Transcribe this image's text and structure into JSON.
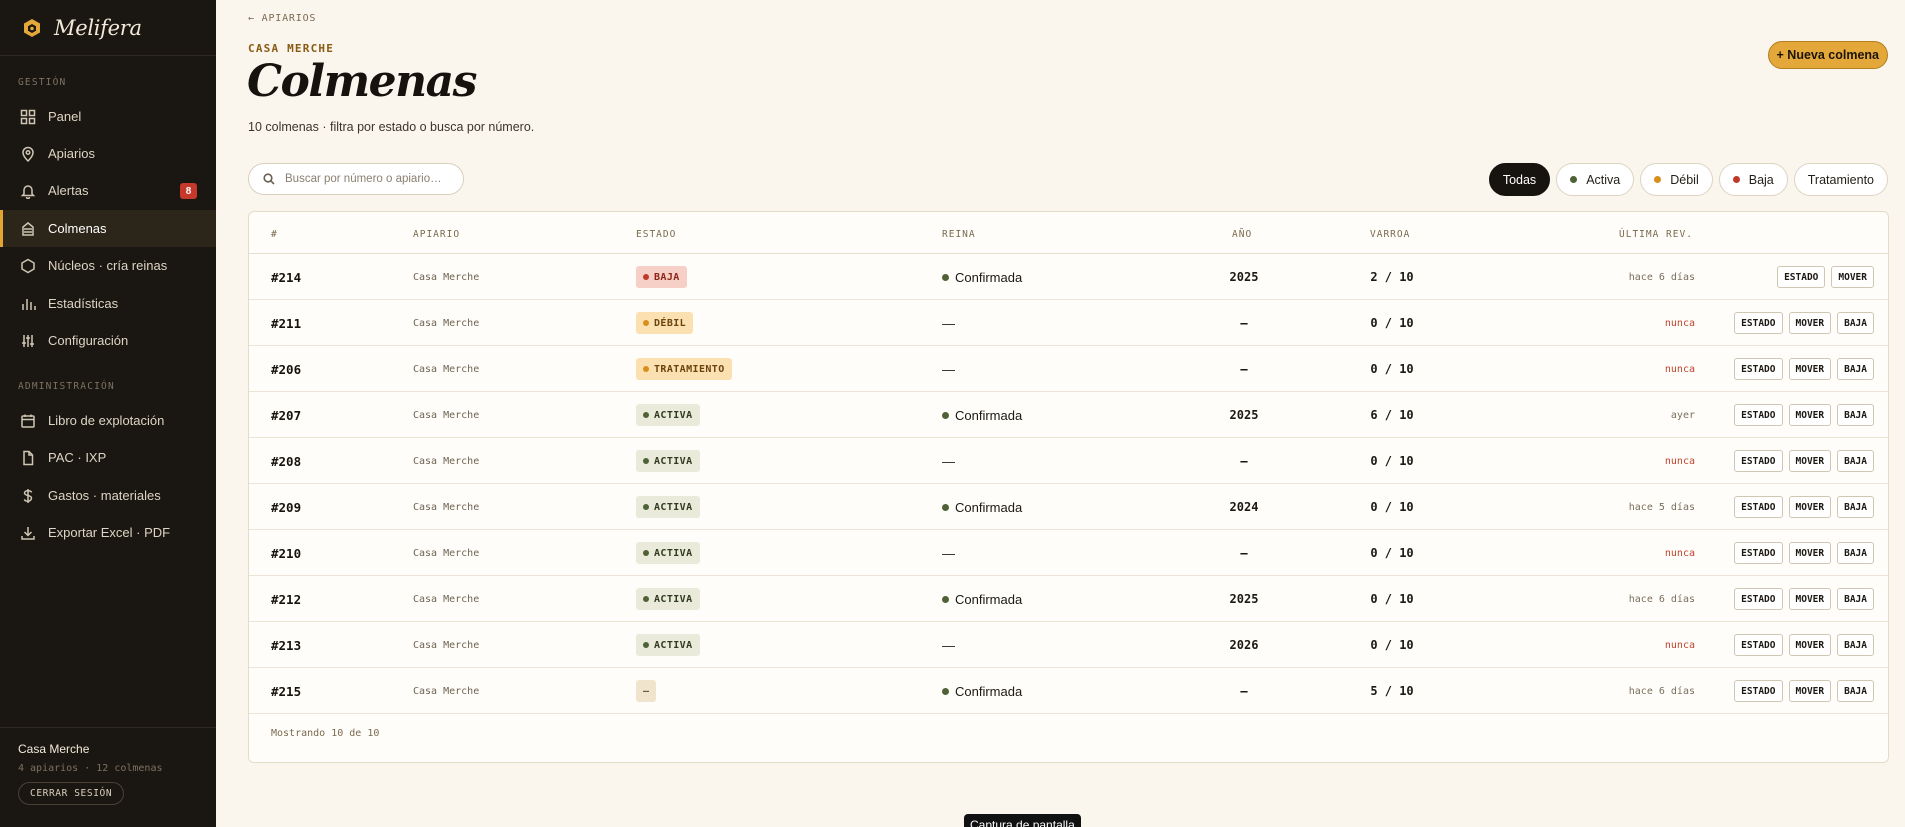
{
  "brand": {
    "name": "Melifera"
  },
  "sidebar": {
    "section_gestion": "GESTIÓN",
    "section_admin": "ADMINISTRACIÓN",
    "items": [
      {
        "label": "Panel",
        "icon": "grid-icon"
      },
      {
        "label": "Apiarios",
        "icon": "map-pin-icon"
      },
      {
        "label": "Alertas",
        "icon": "bell-icon",
        "badge": "8"
      },
      {
        "label": "Colmenas",
        "icon": "hive-icon",
        "active": true
      },
      {
        "label": "Núcleos · cría reinas",
        "icon": "hexagon-icon"
      },
      {
        "label": "Estadísticas",
        "icon": "bar-chart-icon"
      },
      {
        "label": "Configuración",
        "icon": "sliders-icon"
      },
      {
        "label": "Libro de explotación",
        "icon": "calendar-icon"
      },
      {
        "label": "PAC · IXP",
        "icon": "file-icon"
      },
      {
        "label": "Gastos · materiales",
        "icon": "dollar-icon"
      },
      {
        "label": "Exportar Excel · PDF",
        "icon": "download-icon"
      }
    ],
    "footer": {
      "user": "Casa Merche",
      "meta": "4 apiarios · 12 colmenas",
      "logout": "CERRAR SESIÓN"
    }
  },
  "header": {
    "back": "← APIARIOS",
    "eyebrow": "CASA MERCHE",
    "title": "Colmenas",
    "subtitle": "10 colmenas · filtra por estado o busca por número.",
    "new_button": "+ Nueva colmena"
  },
  "search": {
    "placeholder": "Buscar por número o apiario…",
    "value": ""
  },
  "filters": [
    {
      "label": "Todas",
      "selected": true
    },
    {
      "label": "Activa",
      "dot": "#4f6236"
    },
    {
      "label": "Débil",
      "dot": "#d98e1a"
    },
    {
      "label": "Baja",
      "dot": "#c0392b"
    },
    {
      "label": "Tratamiento"
    }
  ],
  "table": {
    "columns": [
      "#",
      "APIARIO",
      "ESTADO",
      "REINA",
      "AÑO",
      "VARROA",
      "ÚLTIMA REV."
    ],
    "rows": [
      {
        "num": "#214",
        "apiario": "Casa Merche",
        "estado": "BAJA",
        "reina": "Confirmada",
        "ano": "2025",
        "varroa": "2 / 10",
        "rev": "hace 6 días",
        "actions": [
          "ESTADO",
          "MOVER"
        ]
      },
      {
        "num": "#211",
        "apiario": "Casa Merche",
        "estado": "DÉBIL",
        "reina": "—",
        "ano": "–",
        "varroa": "0 / 10",
        "rev": "nunca",
        "actions": [
          "ESTADO",
          "MOVER",
          "BAJA"
        ]
      },
      {
        "num": "#206",
        "apiario": "Casa Merche",
        "estado": "TRATAMIENTO",
        "reina": "—",
        "ano": "–",
        "varroa": "0 / 10",
        "rev": "nunca",
        "actions": [
          "ESTADO",
          "MOVER",
          "BAJA"
        ]
      },
      {
        "num": "#207",
        "apiario": "Casa Merche",
        "estado": "ACTIVA",
        "reina": "Confirmada",
        "ano": "2025",
        "varroa": "6 / 10",
        "rev": "ayer",
        "actions": [
          "ESTADO",
          "MOVER",
          "BAJA"
        ]
      },
      {
        "num": "#208",
        "apiario": "Casa Merche",
        "estado": "ACTIVA",
        "reina": "—",
        "ano": "–",
        "varroa": "0 / 10",
        "rev": "nunca",
        "actions": [
          "ESTADO",
          "MOVER",
          "BAJA"
        ]
      },
      {
        "num": "#209",
        "apiario": "Casa Merche",
        "estado": "ACTIVA",
        "reina": "Confirmada",
        "ano": "2024",
        "varroa": "0 / 10",
        "rev": "hace 5 días",
        "actions": [
          "ESTADO",
          "MOVER",
          "BAJA"
        ]
      },
      {
        "num": "#210",
        "apiario": "Casa Merche",
        "estado": "ACTIVA",
        "reina": "—",
        "ano": "–",
        "varroa": "0 / 10",
        "rev": "nunca",
        "actions": [
          "ESTADO",
          "MOVER",
          "BAJA"
        ]
      },
      {
        "num": "#212",
        "apiario": "Casa Merche",
        "estado": "ACTIVA",
        "reina": "Confirmada",
        "ano": "2025",
        "varroa": "0 / 10",
        "rev": "hace 6 días",
        "actions": [
          "ESTADO",
          "MOVER",
          "BAJA"
        ]
      },
      {
        "num": "#213",
        "apiario": "Casa Merche",
        "estado": "ACTIVA",
        "reina": "—",
        "ano": "2026",
        "varroa": "0 / 10",
        "rev": "nunca",
        "actions": [
          "ESTADO",
          "MOVER",
          "BAJA"
        ]
      },
      {
        "num": "#215",
        "apiario": "Casa Merche",
        "estado": "—",
        "reina": "Confirmada",
        "ano": "–",
        "varroa": "5 / 10",
        "rev": "hace 6 días",
        "actions": [
          "ESTADO",
          "MOVER",
          "BAJA"
        ]
      }
    ],
    "footer": "Mostrando 10 de 10"
  },
  "status_colors": {
    "BAJA": {
      "bg": "#f6cfc6",
      "fg": "#8d2416",
      "dot": "#c0392b"
    },
    "DÉBIL": {
      "bg": "#fbe1b2",
      "fg": "#6b430b",
      "dot": "#d98e1a"
    },
    "TRATAMIENTO": {
      "bg": "#fbe1b2",
      "fg": "#6b430b",
      "dot": "#d98e1a"
    },
    "ACTIVA": {
      "bg": "#e9ead9",
      "fg": "#2f3a20",
      "dot": "#4f6236"
    },
    "—": {
      "bg": "#f0e4cc",
      "fg": "#6b5b41",
      "dot": ""
    }
  },
  "tooltip": "Captura de pantalla"
}
